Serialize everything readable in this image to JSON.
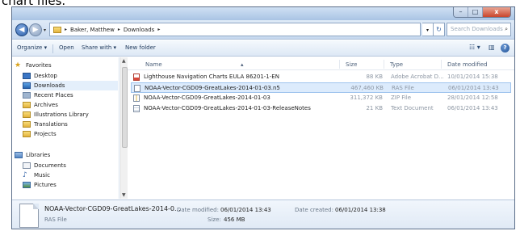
{
  "top_cut_text": "chart files.",
  "window": {
    "caption": {
      "minimize": "–",
      "maximize": "□",
      "close": "x"
    }
  },
  "nav": {
    "back": "◀",
    "forward": "▶",
    "dropdown": "▾",
    "breadcrumbs": [
      "Baker, Matthew",
      "Downloads"
    ],
    "crumb_sep": "▸",
    "refresh": "↻",
    "search_placeholder": "Search Downloads",
    "search_icon": "⌕"
  },
  "toolbar": {
    "organize": "Organize ▾",
    "open": "Open",
    "share_with": "Share with ▾",
    "new_folder": "New folder",
    "views": "☷ ▾",
    "preview": "▥",
    "help": "?"
  },
  "sidebar": {
    "favorites_header": "Favorites",
    "favorites": [
      "Desktop",
      "Downloads",
      "Recent Places",
      "Archives",
      "Illustrations Library",
      "Translations",
      "Projects"
    ],
    "libraries_header": "Libraries",
    "libraries": [
      "Documents",
      "Music",
      "Pictures"
    ]
  },
  "columns": {
    "name": "Name",
    "size": "Size",
    "type": "Type",
    "date_modified": "Date modified"
  },
  "files": [
    {
      "name": "Lighthouse Navigation Charts EULA 86201-1-EN",
      "size": "88 KB",
      "type": "Adobe Acrobat D...",
      "date": "10/01/2014 15:38",
      "icon": "pdf-file-icon",
      "selected": false
    },
    {
      "name": "NOAA-Vector-CGD09-GreatLakes-2014-01-03.n5",
      "size": "467,460 KB",
      "type": "RAS File",
      "date": "06/01/2014 13:43",
      "icon": "generic-file-icon",
      "selected": true
    },
    {
      "name": "NOAA-Vector-CGD09-GreatLakes-2014-01-03",
      "size": "311,372 KB",
      "type": "ZIP File",
      "date": "28/01/2014 12:58",
      "icon": "zip-file-icon",
      "selected": false
    },
    {
      "name": "NOAA-Vector-CGD09-GreatLakes-2014-01-03-ReleaseNotes",
      "size": "21 KB",
      "type": "Text Document",
      "date": "06/01/2014 13:43",
      "icon": "text-file-icon",
      "selected": false
    }
  ],
  "details": {
    "filename": "NOAA-Vector-CGD09-GreatLakes-2014-0...",
    "filetype": "RAS File",
    "date_modified_label": "Date modified:",
    "date_modified": "06/01/2014 13:43",
    "size_label": "Size:",
    "size": "456 MB",
    "date_created_label": "Date created:",
    "date_created": "06/01/2014 13:38"
  }
}
